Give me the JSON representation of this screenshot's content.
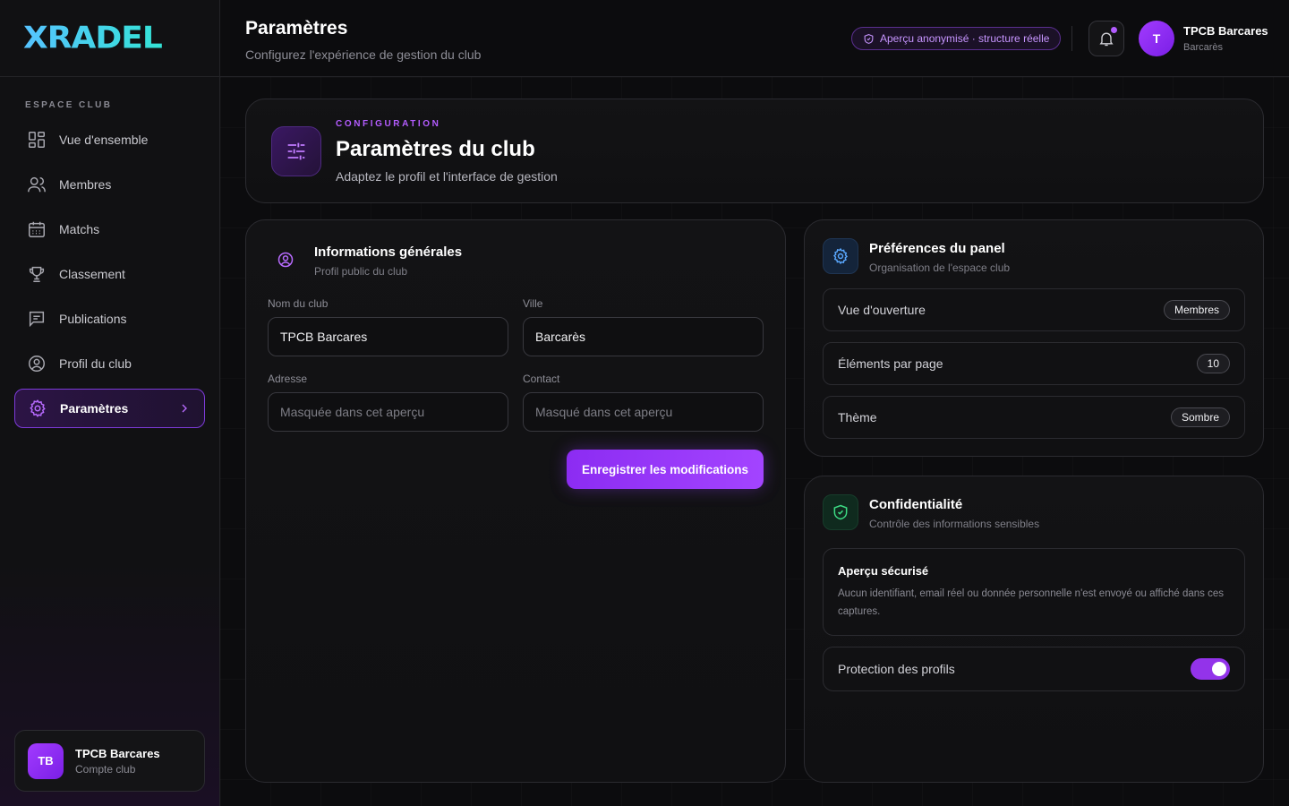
{
  "brand": {
    "logo": "XRADEL"
  },
  "sidebar": {
    "section_label": "ESPACE CLUB",
    "items": [
      {
        "label": "Vue d'ensemble",
        "icon": "grid-icon"
      },
      {
        "label": "Membres",
        "icon": "users-icon"
      },
      {
        "label": "Matchs",
        "icon": "calendar-icon"
      },
      {
        "label": "Classement",
        "icon": "trophy-icon"
      },
      {
        "label": "Publications",
        "icon": "message-icon"
      },
      {
        "label": "Profil du club",
        "icon": "user-circle-icon"
      },
      {
        "label": "Paramètres",
        "icon": "gear-icon",
        "active": true
      }
    ],
    "account": {
      "initials": "TB",
      "name": "TPCB Barcares",
      "subtitle": "Compte club"
    }
  },
  "header": {
    "title": "Paramètres",
    "subtitle": "Configurez l'expérience de gestion du club",
    "badge": "Aperçu anonymisé · structure réelle",
    "user": {
      "initial": "T",
      "name": "TPCB Barcares",
      "location": "Barcarès"
    }
  },
  "hero": {
    "eyebrow": "CONFIGURATION",
    "title": "Paramètres du club",
    "subtitle": "Adaptez le profil et l'interface de gestion"
  },
  "general": {
    "title": "Informations générales",
    "subtitle": "Profil public du club",
    "fields": {
      "name": {
        "label": "Nom du club",
        "value": "TPCB Barcares"
      },
      "city": {
        "label": "Ville",
        "value": "Barcarès"
      },
      "address": {
        "label": "Adresse",
        "placeholder": "Masquée dans cet aperçu"
      },
      "contact": {
        "label": "Contact",
        "placeholder": "Masqué dans cet aperçu"
      }
    },
    "save_label": "Enregistrer les modifications"
  },
  "preferences": {
    "title": "Préférences du panel",
    "subtitle": "Organisation de l'espace club",
    "rows": [
      {
        "label": "Vue d'ouverture",
        "value": "Membres"
      },
      {
        "label": "Éléments par page",
        "value": "10"
      },
      {
        "label": "Thème",
        "value": "Sombre"
      }
    ]
  },
  "privacy": {
    "title": "Confidentialité",
    "subtitle": "Contrôle des informations sensibles",
    "secure_title": "Aperçu sécurisé",
    "secure_text": "Aucun identifiant, email réel ou donnée personnelle n'est envoyé ou affiché dans ces captures.",
    "toggle_label": "Protection des profils",
    "toggle_on": true
  },
  "colors": {
    "accent": "#9333ea",
    "brand": "#34c8ff",
    "success": "#22c55e"
  }
}
